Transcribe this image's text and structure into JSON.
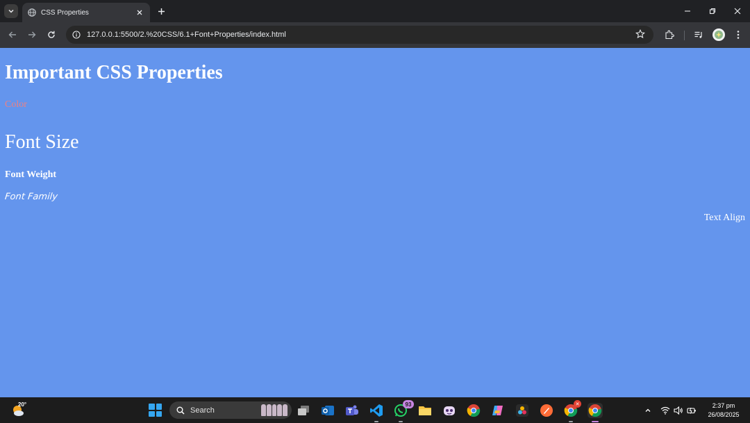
{
  "browser": {
    "tab": {
      "title": "CSS Properties"
    },
    "url": "127.0.0.1:5500/2.%20CSS/6.1+Font+Properties/index.html"
  },
  "page": {
    "heading": "Important CSS Properties",
    "color_text": "Color",
    "font_size_text": "Font Size",
    "font_weight_text": "Font Weight",
    "font_family_text": "Font Family",
    "text_align_text": "Text Align",
    "background_color": "#6495ed",
    "color_text_color": "#f08080"
  },
  "taskbar": {
    "weather_temp": "20°",
    "search_label": "Search",
    "whatsapp_badge": "93",
    "clock_time": "2:37 pm",
    "clock_date": "26/08/2025"
  }
}
